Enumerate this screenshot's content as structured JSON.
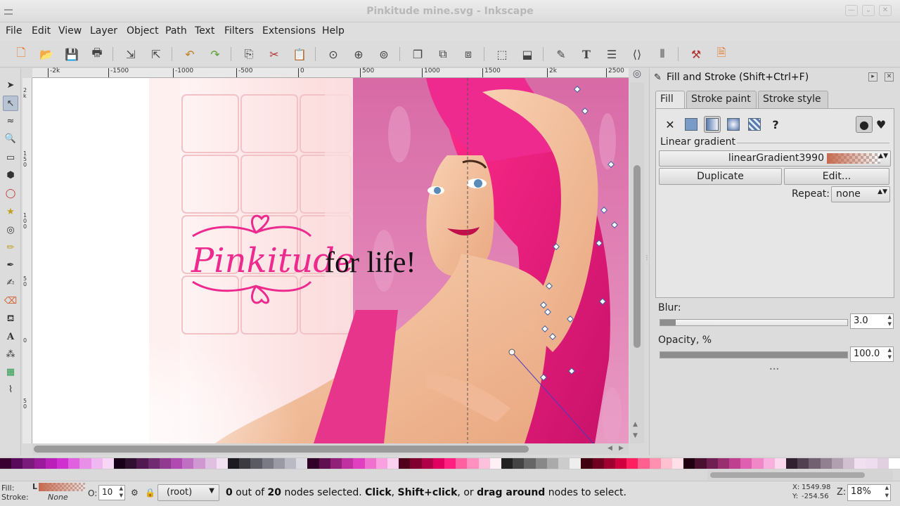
{
  "window": {
    "title": "Pinkitude mine.svg - Inkscape"
  },
  "menu": [
    "File",
    "Edit",
    "View",
    "Layer",
    "Object",
    "Path",
    "Text",
    "Filters",
    "Extensions",
    "Help"
  ],
  "ruler": {
    "h_ticks": [
      "-2k",
      "-1500",
      "-1000",
      "-500",
      "0",
      "500",
      "1000",
      "1500",
      "2k",
      "2500"
    ],
    "v_ticks": [
      "2 k",
      "1 5 0",
      "1 0 0",
      "5 0",
      "0",
      "5 0"
    ]
  },
  "canvas": {
    "logo_script": "Pinkitude",
    "logo_text": "for life!"
  },
  "dock": {
    "title": "Fill and Stroke (Shift+Ctrl+F)",
    "tabs": [
      "Fill",
      "Stroke paint",
      "Stroke style"
    ],
    "active_tab": "Fill",
    "gradient_section": "Linear gradient",
    "gradient_name": "linearGradient3990",
    "duplicate": "Duplicate",
    "edit": "Edit...",
    "repeat_label": "Repeat:",
    "repeat_value": "none",
    "blur_label": "Blur:",
    "blur_value": "3.0",
    "blur_fraction": 0.03,
    "opacity_label": "Opacity, %",
    "opacity_value": "100.0",
    "opacity_fraction": 1.0
  },
  "statusbar": {
    "fill_label": "Fill:",
    "fill_type": "L",
    "stroke_label": "Stroke:",
    "stroke_value": "None",
    "opacity_label": "O:",
    "opacity_value": "10",
    "layer": "(root)",
    "msg_count": "0",
    "msg_of": "out of",
    "msg_total": "20",
    "msg_nodes": "nodes selected.",
    "msg_click": "Click",
    "msg_shift": "Shift+click",
    "msg_or": ", or",
    "msg_drag": "drag around",
    "msg_tail": "nodes to select.",
    "x_label": "X:",
    "x_value": "1549.98",
    "y_label": "Y:",
    "y_value": "-254.56",
    "zoom_label": "Z:",
    "zoom_value": "18%"
  },
  "colors": {
    "pink": "#ee2a8f",
    "canvas_bg": "#ffffff",
    "palette": [
      "#3a0030",
      "#5a0a5a",
      "#7a1a7a",
      "#9a1a9a",
      "#b820b8",
      "#d030d0",
      "#e060e0",
      "#e890e8",
      "#f0b8f0",
      "#f6d8f6",
      "#180018",
      "#301030",
      "#501a50",
      "#702a70",
      "#903a90",
      "#b04ab0",
      "#c070c0",
      "#d098d0",
      "#e0c0e0",
      "#f0e0f0",
      "#1a1a20",
      "#3a3a40",
      "#5a5a62",
      "#7a7a84",
      "#9a9aa4",
      "#babac4",
      "#dadae0",
      "#300028",
      "#601050",
      "#902078",
      "#c030a0",
      "#e040c0",
      "#f070d0",
      "#f8a0e0",
      "#fcd0ef",
      "#50001a",
      "#800030",
      "#b00048",
      "#e00060",
      "#ff2080",
      "#ff60a0",
      "#ff90c0",
      "#ffc0dc",
      "#fff0f6",
      "#222222",
      "#444444",
      "#666666",
      "#888888",
      "#aaaaaa",
      "#cccccc",
      "#eeeeee",
      "#400010",
      "#700020",
      "#a00030",
      "#d00040",
      "#ff2060",
      "#ff6090",
      "#ff90b0",
      "#ffc0d0",
      "#ffe0e8",
      "#200010",
      "#4a1030",
      "#702050",
      "#983070",
      "#c04090",
      "#e060b0",
      "#f088c8",
      "#f8b0dc",
      "#fcd8ee",
      "#302030",
      "#504050",
      "#706070",
      "#908090",
      "#b0a0b0",
      "#d0c0d0",
      "#f0e0f0",
      "#eeddee",
      "#e0d0e0",
      "#ffffff"
    ]
  }
}
